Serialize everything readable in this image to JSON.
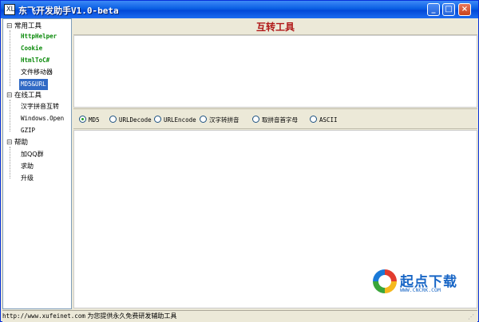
{
  "window": {
    "title": "东飞开发助手V1.0-beta"
  },
  "titlebar_buttons": {
    "minimize": "_",
    "maximize": "□",
    "close": "×"
  },
  "sidebar": {
    "groups": [
      {
        "label": "常用工具",
        "toggle": "⊟",
        "items": [
          "HttpHelper",
          "Cookie",
          "HtmlToC#",
          "文件移动器",
          "MD5&URL"
        ]
      },
      {
        "label": "在线工具",
        "toggle": "⊟",
        "items": [
          "汉字拼音互转",
          "Windows.Open",
          "GZIP"
        ]
      },
      {
        "label": "帮助",
        "toggle": "⊟",
        "items": [
          "加QQ群",
          "求助",
          "升级"
        ]
      }
    ],
    "selected": "MD5&URL"
  },
  "main": {
    "title": "互转工具"
  },
  "options": {
    "selected": "MD5",
    "radios": [
      "MD5",
      "URLDecode",
      "URLEncode",
      "汉字转拼音",
      "取拼音首字母",
      "ASCII"
    ]
  },
  "status": {
    "url": "http://www.xufeinet.com",
    "text": "为您提供永久免费研发辅助工具"
  },
  "watermark": {
    "text": "起点下载",
    "sub": "WWW.CNCRK.COM"
  },
  "colors": {
    "title_red": "#b01818",
    "selection_blue": "#316ac5",
    "green_items": "#0a8a0a"
  }
}
